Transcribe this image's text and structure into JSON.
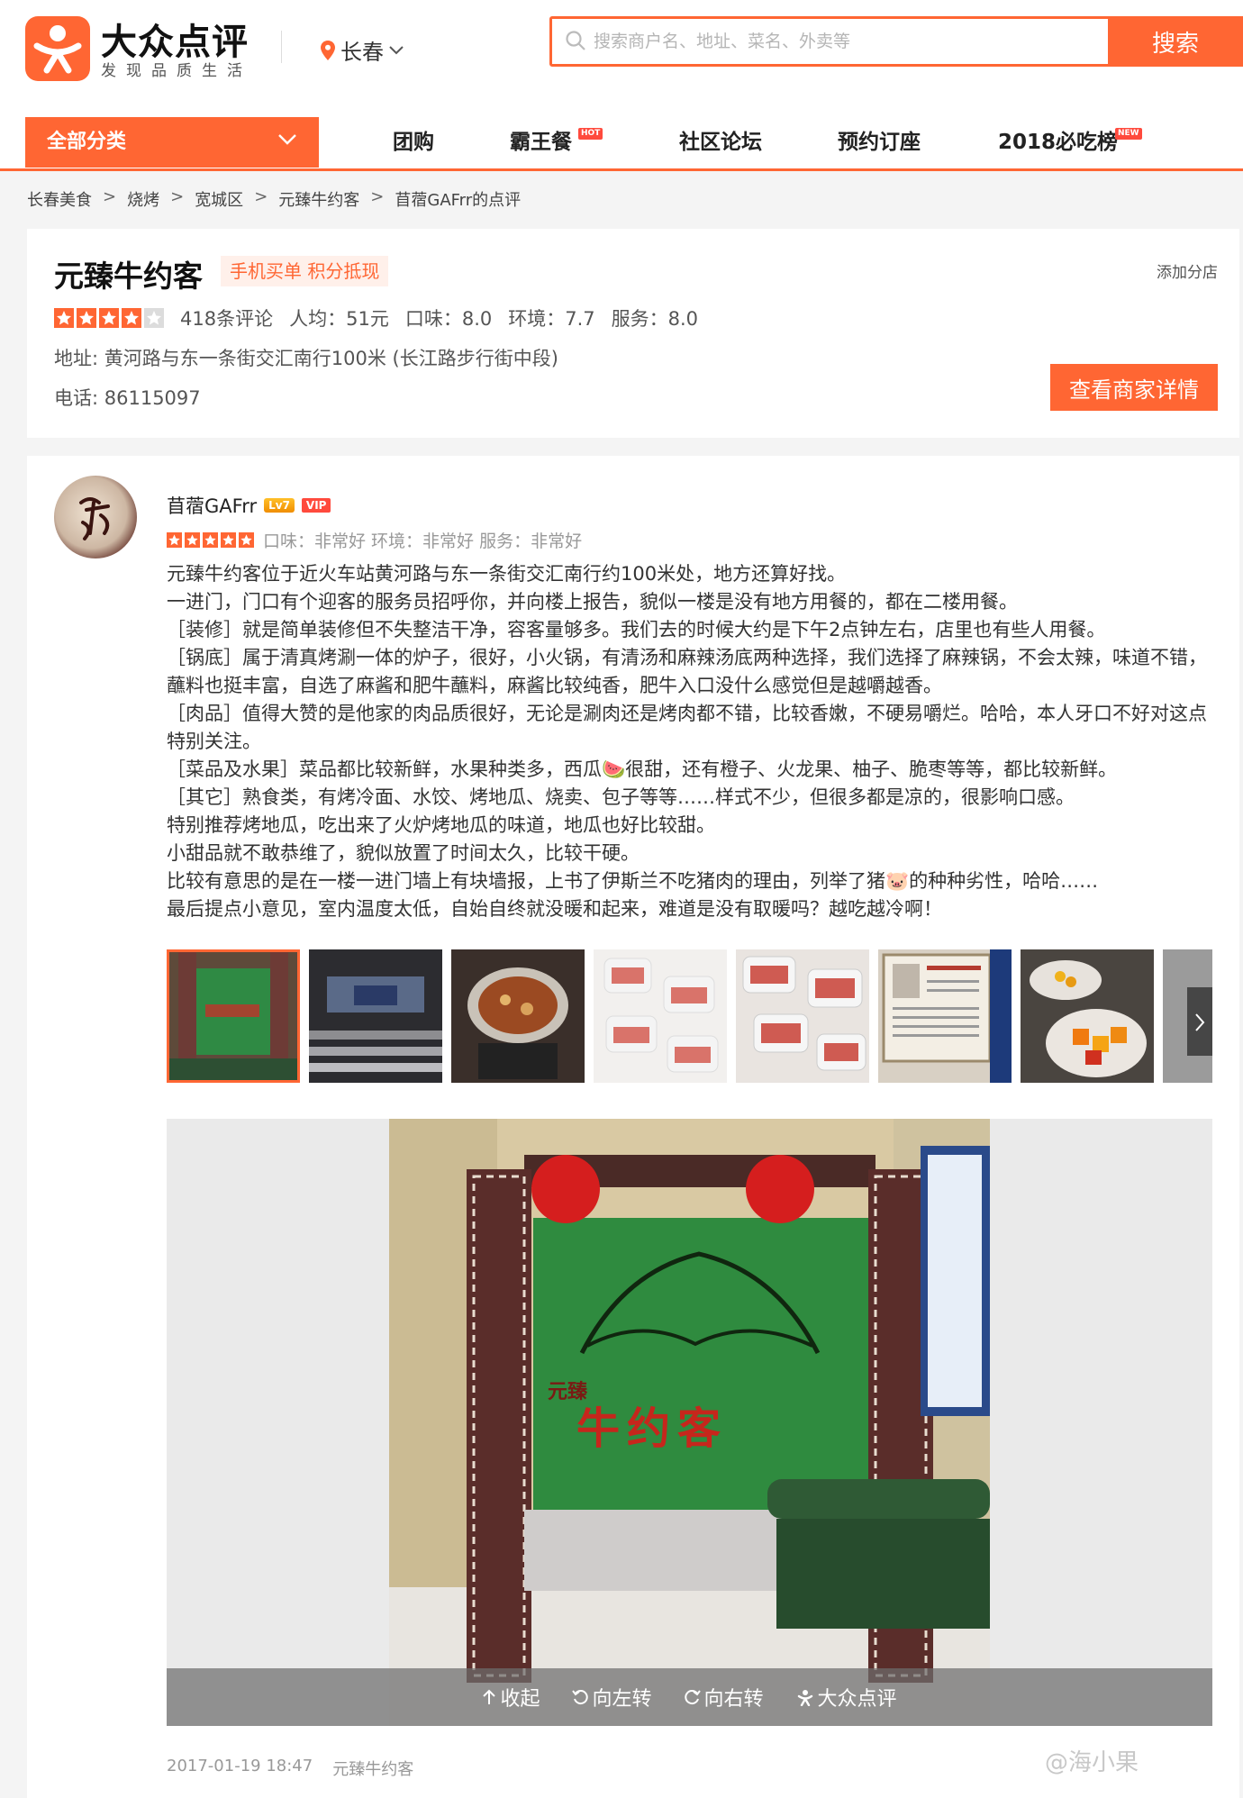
{
  "brand": {
    "name": "大众点评",
    "slogan": "发现品质生活",
    "color": "#ff6633"
  },
  "header": {
    "city": "长春",
    "search_placeholder": "搜索商户名、地址、菜名、外卖等",
    "search_button": "搜索"
  },
  "nav": {
    "all_categories": "全部分类",
    "items": [
      {
        "label": "团购",
        "tag": ""
      },
      {
        "label": "霸王餐",
        "tag": "HOT"
      },
      {
        "label": "社区论坛",
        "tag": ""
      },
      {
        "label": "预约订座",
        "tag": ""
      },
      {
        "label": "2018必吃榜",
        "tag": "NEW"
      }
    ]
  },
  "breadcrumb": [
    "长春美食",
    "烧烤",
    "宽城区",
    "元臻牛约客",
    "苜蓿GAFrr的点评"
  ],
  "shop": {
    "name": "元臻牛约客",
    "badge": "手机买单 积分抵现",
    "add_branch": "添加分店",
    "rating_stars": 4,
    "reviews": "418条评论",
    "avg_price": "人均：51元",
    "taste": "口味：8.0",
    "environment": "环境：7.7",
    "service": "服务：8.0",
    "address": "地址: 黄河路与东一条街交汇南行100米 (长江路步行街中段)",
    "phone": "电话: 86115097",
    "detail_button": "查看商家详情"
  },
  "review": {
    "user": "苜蓿GAFrr",
    "level": "Lv7",
    "vip": "VIP",
    "rating_stars": 5,
    "scores": "口味：非常好  环境：非常好  服务：非常好",
    "paragraphs": [
      "元臻牛约客位于近火车站黄河路与东一条街交汇南行约100米处，地方还算好找。",
      "一进门，门口有个迎客的服务员招呼你，并向楼上报告，貌似一楼是没有地方用餐的，都在二楼用餐。",
      "［装修］就是简单装修但不失整洁干净，容客量够多。我们去的时候大约是下午2点钟左右，店里也有些人用餐。",
      "［锅底］属于清真烤涮一体的炉子，很好，小火锅，有清汤和麻辣汤底两种选择，我们选择了麻辣锅，不会太辣，味道不错，蘸料也挺丰富，自选了麻酱和肥牛蘸料，麻酱比较纯香，肥牛入口没什么感觉但是越嚼越香。",
      "［肉品］值得大赞的是他家的肉品质很好，无论是涮肉还是烤肉都不错，比较香嫩，不硬易嚼烂。哈哈，本人牙口不好对这点特别关注。",
      "［菜品及水果］菜品都比较新鲜，水果种类多，西瓜🍉很甜，还有橙子、火龙果、柚子、脆枣等等，都比较新鲜。",
      "［其它］熟食类，有烤冷面、水饺、烤地瓜、烧卖、包子等等……样式不少，但很多都是凉的，很影响口感。",
      "特别推荐烤地瓜，吃出来了火炉烤地瓜的味道，地瓜也好比较甜。",
      "小甜品就不敢恭维了，貌似放置了时间太久，比较干硬。",
      "比较有意思的是在一楼一进门墙上有块墙报，上书了伊斯兰不吃猪肉的理由，列举了猪🐷的种种劣性，哈哈……",
      "最后提点小意见，室内温度太低，自始自终就没暖和起来，难道是没有取暖吗？越吃越冷啊！"
    ],
    "photo_sign_line1": "元臻",
    "photo_sign_line2": "牛约客",
    "controls": {
      "collapse": "收起",
      "rotate_left": "向左转",
      "rotate_right": "向右转",
      "brand": "大众点评"
    },
    "date": "2017-01-19 18:47",
    "shop_link": "元臻牛约客"
  },
  "watermark": "@海小果"
}
